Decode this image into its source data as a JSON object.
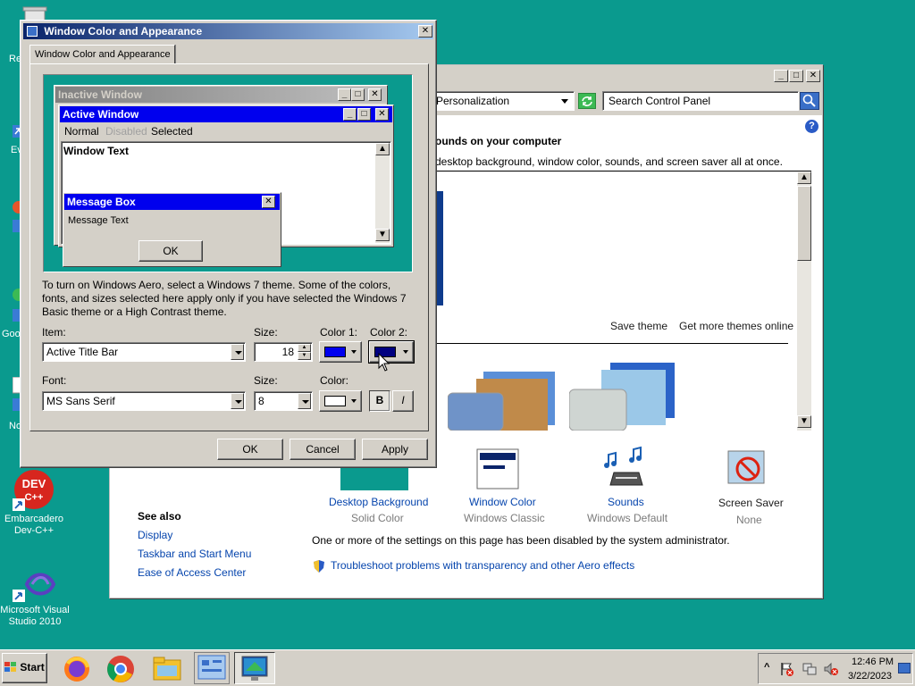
{
  "desktop": {
    "icons": [
      {
        "label": "Re"
      },
      {
        "label": "Ev"
      },
      {
        "label": "Goo"
      },
      {
        "label": "No"
      },
      {
        "label": "Embarcadero\nDev-C++"
      },
      {
        "label": "Microsoft Visual\nStudio 2010"
      }
    ],
    "devcpp_text": "DEV\nC++"
  },
  "control_panel": {
    "address": "Personalization",
    "search_placeholder": "Search Control Panel",
    "heading": "ounds on your computer",
    "subheading": "desktop background, window color, sounds, and screen saver all at once.",
    "save_theme": "Save theme",
    "get_more_themes": "Get more themes online",
    "bottom_items": [
      {
        "label": "Desktop Background",
        "value": "Solid Color"
      },
      {
        "label": "Window Color",
        "value": "Windows Classic"
      },
      {
        "label": "Sounds",
        "value": "Windows Default"
      },
      {
        "label": "Screen Saver",
        "value": "None"
      }
    ],
    "see_also": {
      "title": "See also",
      "links": [
        "Display",
        "Taskbar and Start Menu",
        "Ease of Access Center"
      ]
    },
    "disabled_notice": "One or more of the settings on this page has been disabled by the system administrator.",
    "troubleshoot_link": "Troubleshoot problems with transparency and other Aero effects"
  },
  "dialog": {
    "title": "Window Color and Appearance",
    "tab": "Window Color and Appearance",
    "preview": {
      "inactive_title": "Inactive Window",
      "active_title": "Active Window",
      "menu": [
        "Normal",
        "Disabled",
        "Selected"
      ],
      "window_text": "Window Text",
      "msgbox_title": "Message Box",
      "msgbox_text": "Message Text",
      "ok": "OK"
    },
    "info": "To turn on Windows Aero, select a Windows 7 theme.  Some of the colors, fonts, and sizes selected here apply only if you have selected the Windows 7 Basic theme or a High Contrast theme.",
    "item_label": "Item:",
    "item_value": "Active Title Bar",
    "size_label": "Size:",
    "size_value": "18",
    "color1_label": "Color 1:",
    "color2_label": "Color 2:",
    "color1": "#0000ee",
    "color2": "#000080",
    "font_label": "Font:",
    "font_value": "MS Sans Serif",
    "font_size_label": "Size:",
    "font_size_value": "8",
    "font_color_label": "Color:",
    "font_color": "#ffffff",
    "bold": "B",
    "italic": "I",
    "buttons": {
      "ok": "OK",
      "cancel": "Cancel",
      "apply": "Apply"
    }
  },
  "taskbar": {
    "start": "Start",
    "apps": [
      "firefox-icon",
      "chrome-icon",
      "explorer-icon",
      "control-panel-icon",
      "display-settings-icon"
    ],
    "time": "12:46 PM",
    "date": "3/22/2023"
  }
}
